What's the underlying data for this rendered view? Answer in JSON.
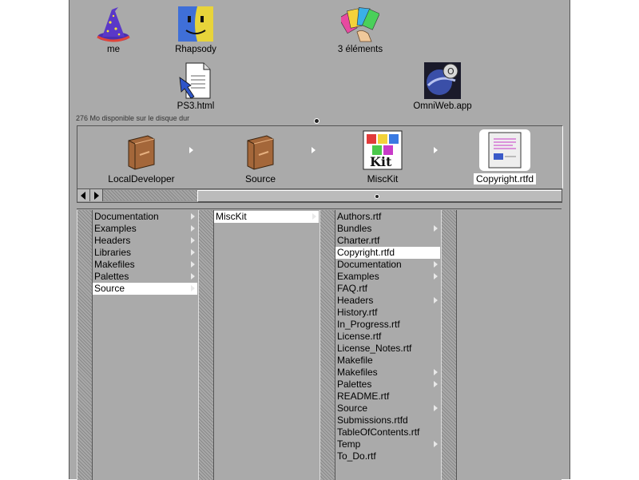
{
  "shelf": {
    "items": [
      {
        "label": "me",
        "icon": "wizard-icon"
      },
      {
        "label": "Rhapsody",
        "icon": "finder-face-icon"
      },
      {
        "label": "3 éléments",
        "icon": "cards-fan-icon"
      },
      {
        "label": "PS3.html",
        "icon": "html-document-icon"
      },
      {
        "label": "OmniWeb.app",
        "icon": "omniweb-icon"
      }
    ]
  },
  "status": {
    "disk_free": "276 Mo disponible sur le disque dur"
  },
  "path": {
    "items": [
      {
        "label": "LocalDeveloper",
        "icon": "folder-icon",
        "selected": false
      },
      {
        "label": "Source",
        "icon": "folder-icon",
        "selected": false
      },
      {
        "label": "MiscKit",
        "icon": "misckit-icon",
        "selected": false
      },
      {
        "label": "Copyright.rtfd",
        "icon": "rtfd-document-icon",
        "selected": true
      }
    ]
  },
  "browser": {
    "col1": [
      {
        "label": "Documentation",
        "branch": true,
        "selected": false
      },
      {
        "label": "Examples",
        "branch": true,
        "selected": false
      },
      {
        "label": "Headers",
        "branch": true,
        "selected": false
      },
      {
        "label": "Libraries",
        "branch": true,
        "selected": false
      },
      {
        "label": "Makefiles",
        "branch": true,
        "selected": false
      },
      {
        "label": "Palettes",
        "branch": true,
        "selected": false
      },
      {
        "label": "Source",
        "branch": true,
        "selected": true
      }
    ],
    "col2": [
      {
        "label": "MiscKit",
        "branch": true,
        "selected": true
      }
    ],
    "col3": [
      {
        "label": "Authors.rtf",
        "branch": false,
        "selected": false
      },
      {
        "label": "Bundles",
        "branch": true,
        "selected": false
      },
      {
        "label": "Charter.rtf",
        "branch": false,
        "selected": false
      },
      {
        "label": "Copyright.rtfd",
        "branch": false,
        "selected": true
      },
      {
        "label": "Documentation",
        "branch": true,
        "selected": false
      },
      {
        "label": "Examples",
        "branch": true,
        "selected": false
      },
      {
        "label": "FAQ.rtf",
        "branch": false,
        "selected": false
      },
      {
        "label": "Headers",
        "branch": true,
        "selected": false
      },
      {
        "label": "History.rtf",
        "branch": false,
        "selected": false
      },
      {
        "label": "In_Progress.rtf",
        "branch": false,
        "selected": false
      },
      {
        "label": "License.rtf",
        "branch": false,
        "selected": false
      },
      {
        "label": "License_Notes.rtf",
        "branch": false,
        "selected": false
      },
      {
        "label": "Makefile",
        "branch": false,
        "selected": false
      },
      {
        "label": "Makefiles",
        "branch": true,
        "selected": false
      },
      {
        "label": "Palettes",
        "branch": true,
        "selected": false
      },
      {
        "label": "README.rtf",
        "branch": false,
        "selected": false
      },
      {
        "label": "Source",
        "branch": true,
        "selected": false
      },
      {
        "label": "Submissions.rtfd",
        "branch": false,
        "selected": false
      },
      {
        "label": "TableOfContents.rtf",
        "branch": false,
        "selected": false
      },
      {
        "label": "Temp",
        "branch": true,
        "selected": false
      },
      {
        "label": "To_Do.rtf",
        "branch": false,
        "selected": false
      }
    ]
  },
  "colors": {
    "window": "#aaaaaa",
    "selection": "#ffffff",
    "shadow": "#555555"
  }
}
